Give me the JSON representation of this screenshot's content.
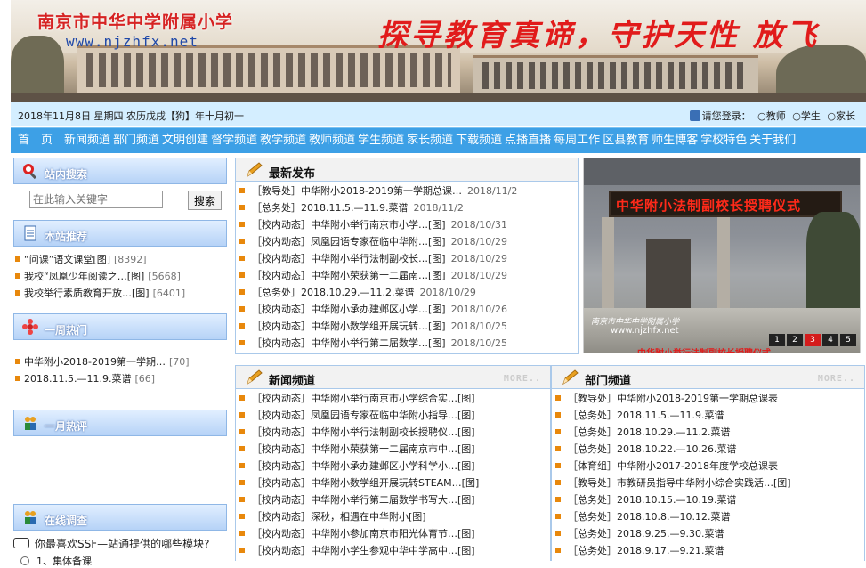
{
  "banner": {
    "school_name": "南京市中华中学附属小学",
    "url_text": "www.njzhfx.net",
    "slogan": "探寻教育真谛，守护天性 放飞"
  },
  "datebar": {
    "date_text": "2018年11月8日 星期四 农历戊戌【狗】年十月初一",
    "login_label": "请您登录：",
    "login_options": [
      "教师",
      "学生",
      "家长"
    ]
  },
  "nav": {
    "items": [
      "首　页",
      "新闻频道",
      "部门频道",
      "文明创建",
      "督学频道",
      "教学频道",
      "教师频道",
      "学生频道",
      "家长频道",
      "下载频道",
      "点播直播",
      "每周工作",
      "区县教育",
      "师生博客",
      "学校特色",
      "关于我们"
    ]
  },
  "sidebar": {
    "search_title": "站内搜索",
    "search_placeholder": "在此输入关键字",
    "search_button": "搜索",
    "recommend_title": "本站推荐",
    "recommend_items": [
      {
        "title": "“问课”语文课堂[图]",
        "count": "[8392]"
      },
      {
        "title": "我校“凤凰少年阅读之…[图]",
        "count": "[5668]"
      },
      {
        "title": "我校举行素质教育开放…[图]",
        "count": "[6401]"
      }
    ],
    "weekly_title": "一周热门",
    "weekly_items": [
      {
        "title": "中华附小2018-2019第一学期…",
        "count": "[70]"
      },
      {
        "title": "2018.11.5.—11.9.菜谱",
        "count": "[66]"
      }
    ],
    "monthly_title": "一月热评",
    "survey_title": "在线调查",
    "survey_question": "你最喜欢SSF—站通提供的哪些模块?",
    "survey_option_1": "1、集体备课"
  },
  "latest": {
    "title": "最新发布",
    "items": [
      {
        "text": "［教导处］中华附小2018-2019第一学期总课…",
        "date": "2018/11/2"
      },
      {
        "text": "［总务处］2018.11.5.—11.9.菜谱",
        "date": "2018/11/2"
      },
      {
        "text": "［校内动态］中华附小举行南京市小学…[图]",
        "date": "2018/10/31"
      },
      {
        "text": "［校内动态］凤凰园语专家莅临中华附…[图]",
        "date": "2018/10/29"
      },
      {
        "text": "［校内动态］中华附小举行法制副校长…[图]",
        "date": "2018/10/29"
      },
      {
        "text": "［校内动态］中华附小荣获第十二届南…[图]",
        "date": "2018/10/29"
      },
      {
        "text": "［总务处］2018.10.29.—11.2.菜谱",
        "date": "2018/10/29"
      },
      {
        "text": "［校内动态］中华附小承办建邺区小学…[图]",
        "date": "2018/10/26"
      },
      {
        "text": "［校内动态］中华附小数学组开展玩转…[图]",
        "date": "2018/10/25"
      },
      {
        "text": "［校内动态］中华附小举行第二届数学…[图]",
        "date": "2018/10/25"
      }
    ]
  },
  "photo": {
    "led_text": "中华附小法制副校长授聘仪式",
    "caption": "南京市中华中学附属小学",
    "url": "www.njzhfx.net",
    "subtitle": "中华附小举行法制副校长授聘仪式",
    "pages": [
      "1",
      "2",
      "3",
      "4",
      "5"
    ],
    "active_page": "3"
  },
  "news_channel": {
    "title": "新闻频道",
    "more": "MORE..",
    "items": [
      "［校内动态］中华附小举行南京市小学综合实…[图]",
      "［校内动态］凤凰园语专家莅临中华附小指导…[图]",
      "［校内动态］中华附小举行法制副校长授聘仪…[图]",
      "［校内动态］中华附小荣获第十二届南京市中…[图]",
      "［校内动态］中华附小承办建邺区小学科学小…[图]",
      "［校内动态］中华附小数学组开展玩转STEAM…[图]",
      "［校内动态］中华附小举行第二届数学书写大…[图]",
      "［校内动态］深秋，相遇在中华附小[图]",
      "［校内动态］中华附小参加南京市阳光体育节…[图]",
      "［校内动态］中华附小学生参观中华中学高中…[图]"
    ]
  },
  "dept_channel": {
    "title": "部门频道",
    "more": "MORE..",
    "items": [
      "［教导处］中华附小2018-2019第一学期总课表",
      "［总务处］2018.11.5.—11.9.菜谱",
      "［总务处］2018.10.29.—11.2.菜谱",
      "［总务处］2018.10.22.—10.26.菜谱",
      "［体育组］中华附小2017-2018年度学校总课表",
      "［教导处］市教研员指导中华附小综合实践活…[图]",
      "［总务处］2018.10.15.—10.19.菜谱",
      "［总务处］2018.10.8.—10.12.菜谱",
      "［总务处］2018.9.25.—9.30.菜谱",
      "［总务处］2018.9.17.—9.21.菜谱"
    ]
  }
}
